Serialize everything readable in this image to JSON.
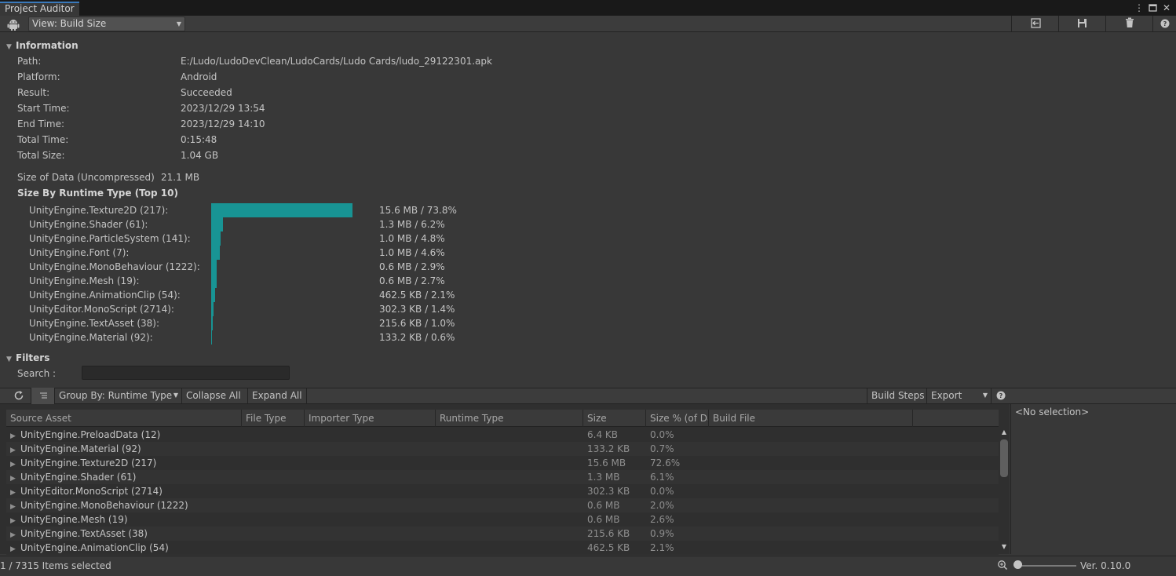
{
  "window": {
    "tab_title": "Project Auditor"
  },
  "toolbar": {
    "platform_icon": "android-icon",
    "view_selector": "View: Build Size",
    "icons": [
      "import-icon",
      "save-icon",
      "trash-icon",
      "help-icon"
    ]
  },
  "information": {
    "heading": "Information",
    "rows": [
      {
        "label": "Path:",
        "value": "E:/Ludo/LudoDevClean/LudoCards/Ludo Cards/ludo_29122301.apk"
      },
      {
        "label": "Platform:",
        "value": "Android"
      },
      {
        "label": "Result:",
        "value": "Succeeded"
      },
      {
        "label": "Start Time:",
        "value": "2023/12/29 13:54"
      },
      {
        "label": "End Time:",
        "value": "2023/12/29 14:10"
      },
      {
        "label": "Total Time:",
        "value": "0:15:48"
      },
      {
        "label": "Total Size:",
        "value": "1.04 GB"
      }
    ],
    "data_size_label": "Size of Data (Uncompressed)",
    "data_size_value": "21.1 MB",
    "runtime_type_heading": "Size By Runtime Type (Top 10)",
    "runtime_types": [
      {
        "label": "UnityEngine.Texture2D (217):",
        "value": "15.6 MB / 73.8%",
        "percent": 73.8
      },
      {
        "label": "UnityEngine.Shader (61):",
        "value": "1.3 MB / 6.2%",
        "percent": 6.2
      },
      {
        "label": "UnityEngine.ParticleSystem (141):",
        "value": "1.0 MB / 4.8%",
        "percent": 4.8
      },
      {
        "label": "UnityEngine.Font (7):",
        "value": "1.0 MB / 4.6%",
        "percent": 4.6
      },
      {
        "label": "UnityEngine.MonoBehaviour (1222):",
        "value": "0.6 MB / 2.9%",
        "percent": 2.9
      },
      {
        "label": "UnityEngine.Mesh (19):",
        "value": "0.6 MB / 2.7%",
        "percent": 2.7
      },
      {
        "label": "UnityEngine.AnimationClip (54):",
        "value": "462.5 KB / 2.1%",
        "percent": 2.1
      },
      {
        "label": "UnityEditor.MonoScript (2714):",
        "value": "302.3 KB / 1.4%",
        "percent": 1.4
      },
      {
        "label": "UnityEngine.TextAsset (38):",
        "value": "215.6 KB / 1.0%",
        "percent": 1.0
      },
      {
        "label": "UnityEngine.Material (92):",
        "value": "133.2 KB / 0.6%",
        "percent": 0.6
      }
    ]
  },
  "filters": {
    "heading": "Filters",
    "search_label": "Search :",
    "search_value": ""
  },
  "table_toolbar": {
    "group_by": "Group By: Runtime Type",
    "collapse_all": "Collapse All",
    "expand_all": "Expand All",
    "build_steps": "Build Steps",
    "export": "Export"
  },
  "table": {
    "columns": [
      "Source Asset",
      "File Type",
      "Importer Type",
      "Runtime Type",
      "Size",
      "Size % (of Da",
      "Build File"
    ],
    "rows": [
      {
        "name": "UnityEngine.PreloadData (12)",
        "size": "6.4 KB",
        "pct": "0.0%"
      },
      {
        "name": "UnityEngine.Material (92)",
        "size": "133.2 KB",
        "pct": "0.7%"
      },
      {
        "name": "UnityEngine.Texture2D (217)",
        "size": "15.6 MB",
        "pct": "72.6%"
      },
      {
        "name": "UnityEngine.Shader (61)",
        "size": "1.3 MB",
        "pct": "6.1%"
      },
      {
        "name": "UnityEditor.MonoScript (2714)",
        "size": "302.3 KB",
        "pct": "0.0%"
      },
      {
        "name": "UnityEngine.MonoBehaviour (1222)",
        "size": "0.6 MB",
        "pct": "2.0%"
      },
      {
        "name": "UnityEngine.Mesh (19)",
        "size": "0.6 MB",
        "pct": "2.6%"
      },
      {
        "name": "UnityEngine.TextAsset (38)",
        "size": "215.6 KB",
        "pct": "0.9%"
      },
      {
        "name": "UnityEngine.AnimationClip (54)",
        "size": "462.5 KB",
        "pct": "2.1%"
      }
    ]
  },
  "side_panel": {
    "placeholder": "<No selection>"
  },
  "status": {
    "items_selected": "1 / 7315 Items selected",
    "version": "Ver. 0.10.0"
  },
  "colors": {
    "bar": "#189494",
    "background": "#383838",
    "tab_accent": "#3a79bb"
  }
}
